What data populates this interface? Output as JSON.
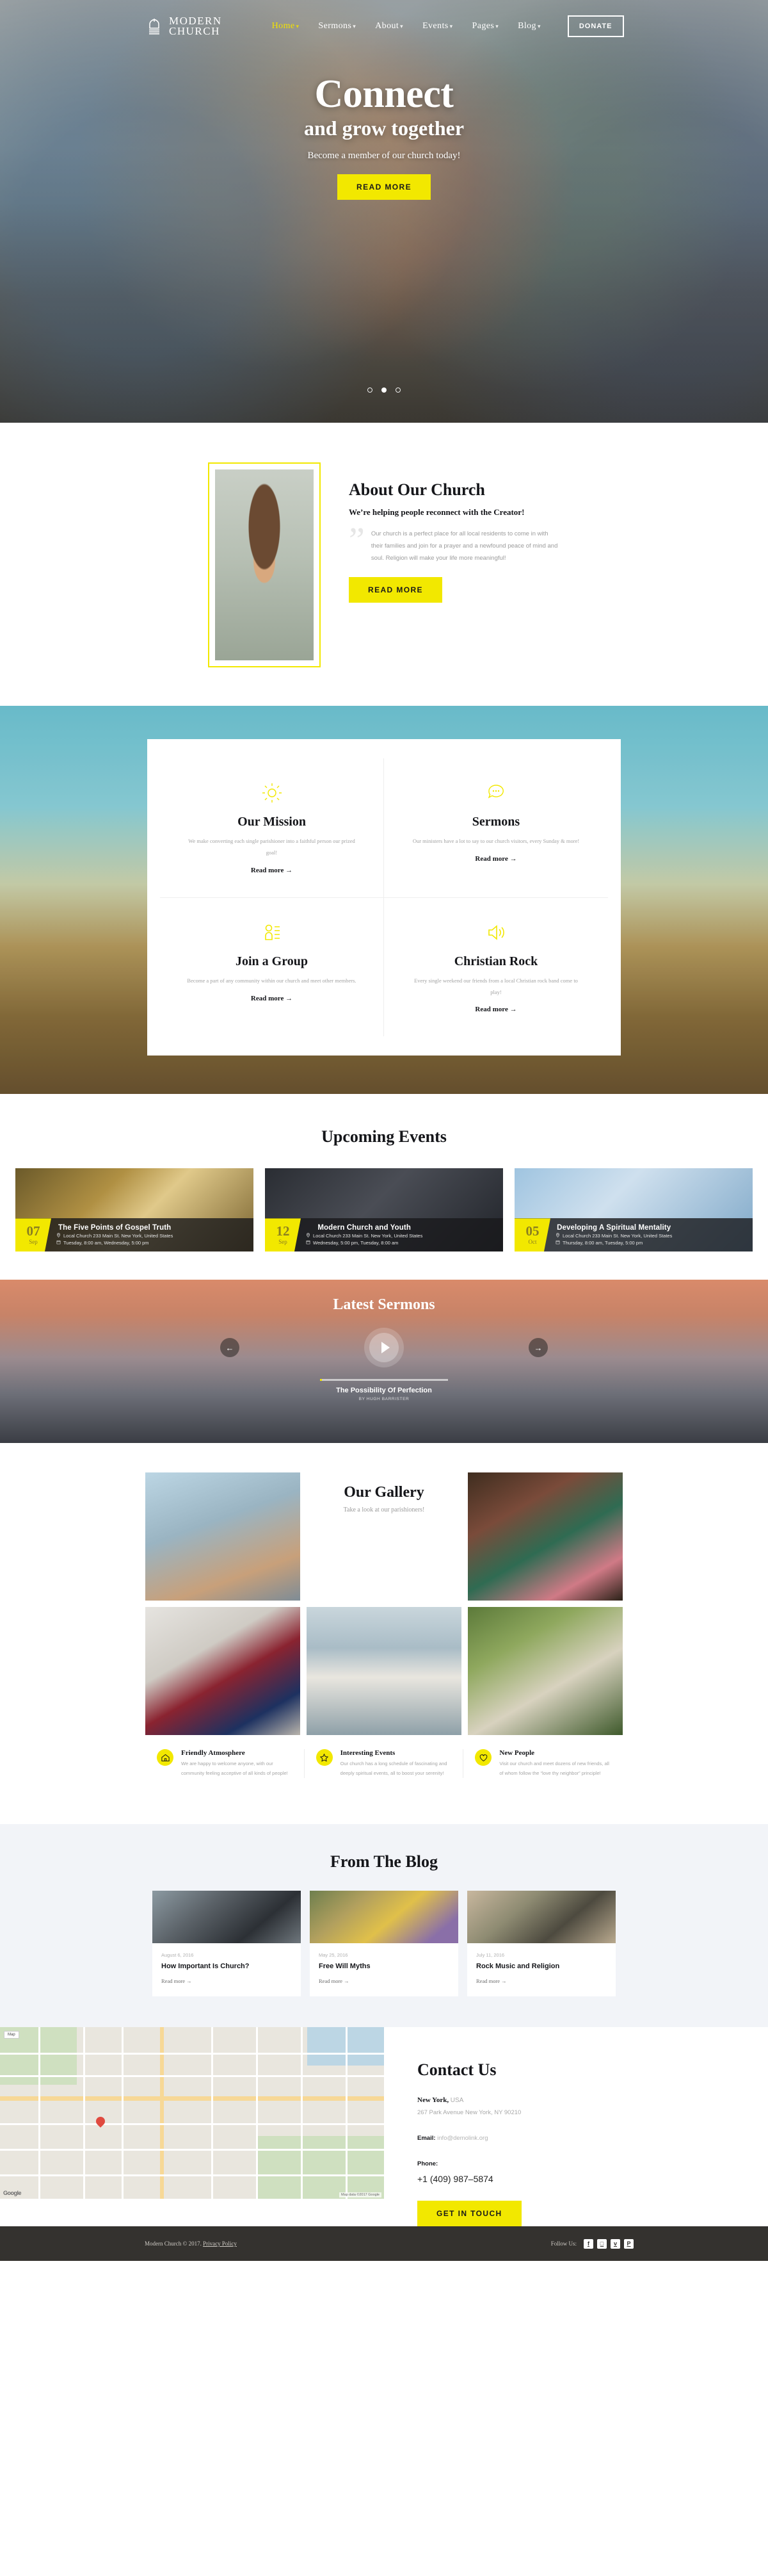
{
  "brand": {
    "line1": "MODERN",
    "line2": "CHURCH",
    "accent": "#f2e800"
  },
  "nav": {
    "items": [
      {
        "label": "Home",
        "active": true
      },
      {
        "label": "Sermons",
        "active": false
      },
      {
        "label": "About",
        "active": false
      },
      {
        "label": "Events",
        "active": false
      },
      {
        "label": "Pages",
        "active": false
      },
      {
        "label": "Blog",
        "active": false
      }
    ],
    "donate_label": "DONATE"
  },
  "hero": {
    "title": "Connect",
    "subtitle": "and grow together",
    "tagline": "Become a member of our church today!",
    "cta": "READ MORE"
  },
  "about": {
    "heading": "About Our Church",
    "subheading": "We’re helping people reconnect with the Creator!",
    "body": "Our church is a perfect place for all local residents to come in with their families and join for a prayer and a newfound peace of mind and soul. Religion will make your life more meaningful!",
    "cta": "READ MORE"
  },
  "services": {
    "items": [
      {
        "icon": "sun-icon",
        "title": "Our Mission",
        "text": "We make converting each single parishioner into a faithful person our prized goal!",
        "link": "Read more →"
      },
      {
        "icon": "speech-bubble-icon",
        "title": "Sermons",
        "text": "Our ministers have a lot to say to our church visitors, every Sunday & more!",
        "link": "Read more →"
      },
      {
        "icon": "person-list-icon",
        "title": "Join a Group",
        "text": "Become a part of any community within our church and meet other members.",
        "link": "Read more →"
      },
      {
        "icon": "speaker-icon",
        "title": "Christian Rock",
        "text": "Every single weekend our friends from a local Christian rock band come to play!",
        "link": "Read more →"
      }
    ]
  },
  "events": {
    "title": "Upcoming Events",
    "items": [
      {
        "day": "07",
        "month": "Sep",
        "title": "The Five Points of Gospel Truth",
        "location": "Local Church 233 Main St. New York, United States",
        "time": "Tuesday, 8:00 am, Wednesday, 5:00 pm"
      },
      {
        "day": "12",
        "month": "Sep",
        "title": "Modern Church and Youth",
        "location": "Local Church 233 Main St. New York, United States",
        "time": "Wednesday, 5:00 pm, Tuesday, 8:00 am"
      },
      {
        "day": "05",
        "month": "Oct",
        "title": "Developing A Spiritual Mentality",
        "location": "Local Church 233 Main St. New York, United States",
        "time": "Thursday, 8:00 am, Tuesday, 5:00 pm"
      }
    ]
  },
  "sermons": {
    "title": "Latest Sermons",
    "track_title": "The Possibility Of Perfection",
    "track_author": "BY HUGH BARRISTER",
    "prev": "←",
    "next": "→"
  },
  "gallery": {
    "title": "Our Gallery",
    "subtitle": "Take a look at our parishioners!"
  },
  "features": {
    "items": [
      {
        "icon": "home-icon",
        "title": "Friendly Atmosphere",
        "text": "We are happy to welcome anyone, with our community feeling acceptive of all kinds of people!"
      },
      {
        "icon": "star-icon",
        "title": "Interesting Events",
        "text": "Our church has a long schedule of fascinating and deeply spiritual events, all to boost your serenity!"
      },
      {
        "icon": "heart-icon",
        "title": "New People",
        "text": "Visit our church and meet dozens of new friends, all of whom follow the “love thy neighbor” principle!"
      }
    ]
  },
  "blog": {
    "title": "From The Blog",
    "posts": [
      {
        "date": "August 6, 2016",
        "title": "How Important Is Church?",
        "link": "Read more →"
      },
      {
        "date": "May 25, 2016",
        "title": "Free Will Myths",
        "link": "Read more →"
      },
      {
        "date": "July 11, 2016",
        "title": "Rock Music and Religion",
        "link": "Read more →"
      }
    ]
  },
  "contact": {
    "title": "Contact Us",
    "city": "New York,",
    "country": "USA",
    "address": "267 Park Avenue New York, NY 90210",
    "email_label": "Email:",
    "email": "info@demolink.org",
    "phone_label": "Phone:",
    "phone": "+1 (409) 987–5874",
    "cta": "GET IN TOUCH",
    "map_credit": "Map data ©2017 Google",
    "map_logo": "Google",
    "map_button": "Map"
  },
  "footer": {
    "copyright": "Modern Church © 2017.",
    "privacy": "Privacy Policy",
    "follow_label": "Follow Us:",
    "socials": [
      {
        "name": "facebook-icon",
        "glyph": "f"
      },
      {
        "name": "instagram-icon",
        "glyph": "□"
      },
      {
        "name": "twitter-icon",
        "glyph": "ᴠ"
      },
      {
        "name": "pinterest-icon",
        "glyph": "P"
      }
    ]
  }
}
